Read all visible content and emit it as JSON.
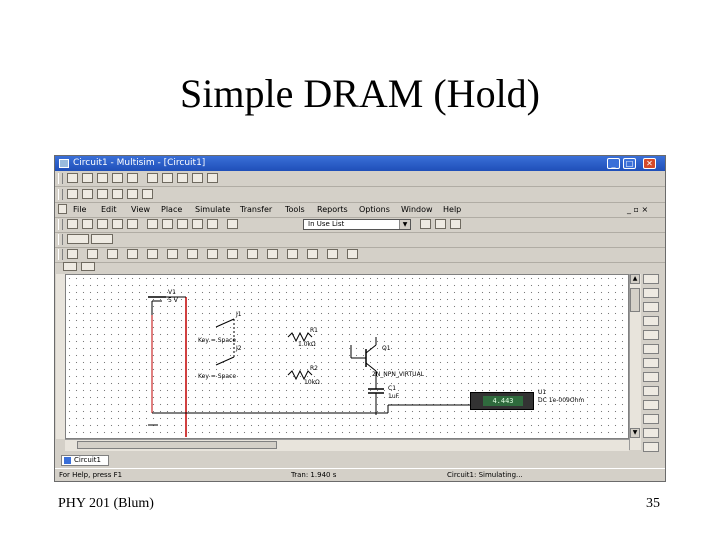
{
  "slide": {
    "title": "Simple DRAM (Hold)",
    "footer_left": "PHY 201 (Blum)",
    "footer_right": "35"
  },
  "window": {
    "title": "Circuit1 - Multisim - [Circuit1]",
    "min_glyph": "_",
    "max_glyph": "□",
    "close_glyph": "✕"
  },
  "menu": {
    "items": [
      "File",
      "Edit",
      "View",
      "Place",
      "Simulate",
      "Transfer",
      "Tools",
      "Reports",
      "Options",
      "Window",
      "Help"
    ]
  },
  "toolbar": {
    "in_use_list": "In Use List",
    "mdi_buttons": "_ ▫ ×"
  },
  "circuit": {
    "components": {
      "v1": "V1",
      "v1_value": "5 V",
      "j1": "J1",
      "j1_key": "Key = Space",
      "j2": "J2",
      "j2_key": "Key = Space",
      "r1": "R1",
      "r1_value": "1.0kΩ",
      "r2": "R2",
      "r2_value": "10kΩ",
      "q1": "Q1",
      "q1_model": "2N_NPN_VIRTUAL",
      "c1": "C1",
      "c1_value": "1uF",
      "u1": "U1",
      "u1_value": "DC 1e-009Ohm"
    },
    "multimeter_reading": "4.443"
  },
  "tabs": {
    "circuit_tab": "Circuit1"
  },
  "status": {
    "help": "For Help, press F1",
    "tran": "Tran: 1.940 s",
    "sim": "Circuit1: Simulating..."
  },
  "colors": {
    "wire_red": "#c00000",
    "wire_black": "#000000",
    "titlebar": "#1f4fb8"
  }
}
